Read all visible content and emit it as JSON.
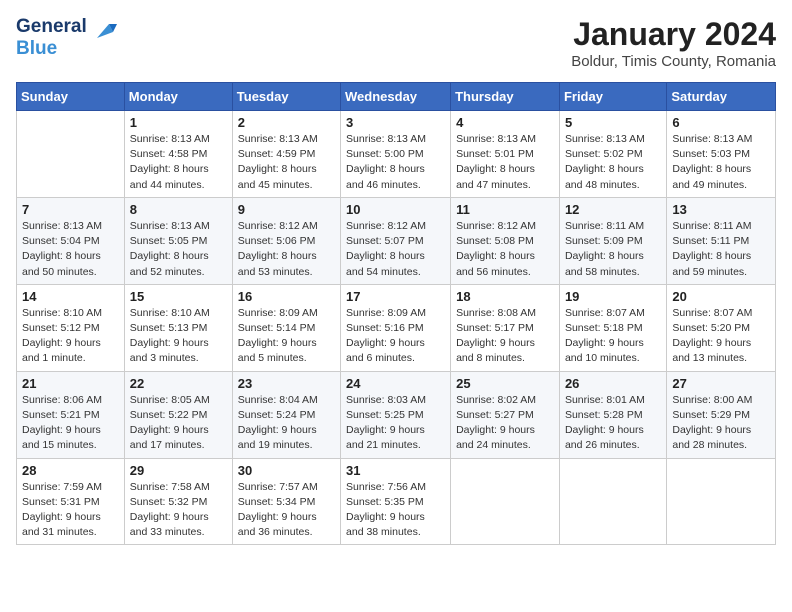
{
  "logo": {
    "line1": "General",
    "line2": "Blue"
  },
  "title": "January 2024",
  "subtitle": "Boldur, Timis County, Romania",
  "weekdays": [
    "Sunday",
    "Monday",
    "Tuesday",
    "Wednesday",
    "Thursday",
    "Friday",
    "Saturday"
  ],
  "weeks": [
    [
      {
        "day": "",
        "info": ""
      },
      {
        "day": "1",
        "info": "Sunrise: 8:13 AM\nSunset: 4:58 PM\nDaylight: 8 hours\nand 44 minutes."
      },
      {
        "day": "2",
        "info": "Sunrise: 8:13 AM\nSunset: 4:59 PM\nDaylight: 8 hours\nand 45 minutes."
      },
      {
        "day": "3",
        "info": "Sunrise: 8:13 AM\nSunset: 5:00 PM\nDaylight: 8 hours\nand 46 minutes."
      },
      {
        "day": "4",
        "info": "Sunrise: 8:13 AM\nSunset: 5:01 PM\nDaylight: 8 hours\nand 47 minutes."
      },
      {
        "day": "5",
        "info": "Sunrise: 8:13 AM\nSunset: 5:02 PM\nDaylight: 8 hours\nand 48 minutes."
      },
      {
        "day": "6",
        "info": "Sunrise: 8:13 AM\nSunset: 5:03 PM\nDaylight: 8 hours\nand 49 minutes."
      }
    ],
    [
      {
        "day": "7",
        "info": "Sunrise: 8:13 AM\nSunset: 5:04 PM\nDaylight: 8 hours\nand 50 minutes."
      },
      {
        "day": "8",
        "info": "Sunrise: 8:13 AM\nSunset: 5:05 PM\nDaylight: 8 hours\nand 52 minutes."
      },
      {
        "day": "9",
        "info": "Sunrise: 8:12 AM\nSunset: 5:06 PM\nDaylight: 8 hours\nand 53 minutes."
      },
      {
        "day": "10",
        "info": "Sunrise: 8:12 AM\nSunset: 5:07 PM\nDaylight: 8 hours\nand 54 minutes."
      },
      {
        "day": "11",
        "info": "Sunrise: 8:12 AM\nSunset: 5:08 PM\nDaylight: 8 hours\nand 56 minutes."
      },
      {
        "day": "12",
        "info": "Sunrise: 8:11 AM\nSunset: 5:09 PM\nDaylight: 8 hours\nand 58 minutes."
      },
      {
        "day": "13",
        "info": "Sunrise: 8:11 AM\nSunset: 5:11 PM\nDaylight: 8 hours\nand 59 minutes."
      }
    ],
    [
      {
        "day": "14",
        "info": "Sunrise: 8:10 AM\nSunset: 5:12 PM\nDaylight: 9 hours\nand 1 minute."
      },
      {
        "day": "15",
        "info": "Sunrise: 8:10 AM\nSunset: 5:13 PM\nDaylight: 9 hours\nand 3 minutes."
      },
      {
        "day": "16",
        "info": "Sunrise: 8:09 AM\nSunset: 5:14 PM\nDaylight: 9 hours\nand 5 minutes."
      },
      {
        "day": "17",
        "info": "Sunrise: 8:09 AM\nSunset: 5:16 PM\nDaylight: 9 hours\nand 6 minutes."
      },
      {
        "day": "18",
        "info": "Sunrise: 8:08 AM\nSunset: 5:17 PM\nDaylight: 9 hours\nand 8 minutes."
      },
      {
        "day": "19",
        "info": "Sunrise: 8:07 AM\nSunset: 5:18 PM\nDaylight: 9 hours\nand 10 minutes."
      },
      {
        "day": "20",
        "info": "Sunrise: 8:07 AM\nSunset: 5:20 PM\nDaylight: 9 hours\nand 13 minutes."
      }
    ],
    [
      {
        "day": "21",
        "info": "Sunrise: 8:06 AM\nSunset: 5:21 PM\nDaylight: 9 hours\nand 15 minutes."
      },
      {
        "day": "22",
        "info": "Sunrise: 8:05 AM\nSunset: 5:22 PM\nDaylight: 9 hours\nand 17 minutes."
      },
      {
        "day": "23",
        "info": "Sunrise: 8:04 AM\nSunset: 5:24 PM\nDaylight: 9 hours\nand 19 minutes."
      },
      {
        "day": "24",
        "info": "Sunrise: 8:03 AM\nSunset: 5:25 PM\nDaylight: 9 hours\nand 21 minutes."
      },
      {
        "day": "25",
        "info": "Sunrise: 8:02 AM\nSunset: 5:27 PM\nDaylight: 9 hours\nand 24 minutes."
      },
      {
        "day": "26",
        "info": "Sunrise: 8:01 AM\nSunset: 5:28 PM\nDaylight: 9 hours\nand 26 minutes."
      },
      {
        "day": "27",
        "info": "Sunrise: 8:00 AM\nSunset: 5:29 PM\nDaylight: 9 hours\nand 28 minutes."
      }
    ],
    [
      {
        "day": "28",
        "info": "Sunrise: 7:59 AM\nSunset: 5:31 PM\nDaylight: 9 hours\nand 31 minutes."
      },
      {
        "day": "29",
        "info": "Sunrise: 7:58 AM\nSunset: 5:32 PM\nDaylight: 9 hours\nand 33 minutes."
      },
      {
        "day": "30",
        "info": "Sunrise: 7:57 AM\nSunset: 5:34 PM\nDaylight: 9 hours\nand 36 minutes."
      },
      {
        "day": "31",
        "info": "Sunrise: 7:56 AM\nSunset: 5:35 PM\nDaylight: 9 hours\nand 38 minutes."
      },
      {
        "day": "",
        "info": ""
      },
      {
        "day": "",
        "info": ""
      },
      {
        "day": "",
        "info": ""
      }
    ]
  ]
}
